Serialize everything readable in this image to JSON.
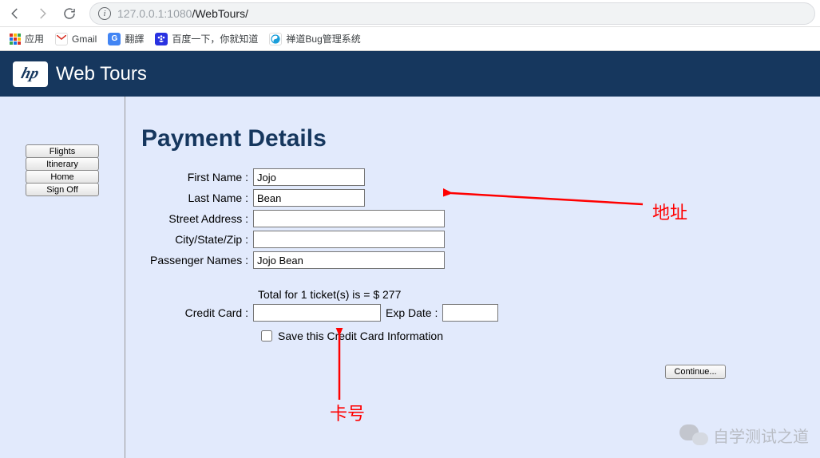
{
  "browser": {
    "url_host": "127.0.0.1",
    "url_port": ":1080",
    "url_path": "/WebTours/"
  },
  "bookmarks": {
    "apps": "应用",
    "gmail": "Gmail",
    "translate": "翻譯",
    "baidu": "百度一下，你就知道",
    "zentao": "禅道Bug管理系统"
  },
  "banner": {
    "title": "Web Tours"
  },
  "sidebar": {
    "flights": "Flights",
    "itinerary": "Itinerary",
    "home": "Home",
    "signoff": "Sign Off"
  },
  "page": {
    "title": "Payment Details",
    "labels": {
      "first_name": "First Name :",
      "last_name": "Last Name :",
      "street": "Street Address :",
      "city": "City/State/Zip :",
      "passenger": "Passenger Names :",
      "credit_card": "Credit Card :",
      "exp_date": "Exp Date :",
      "save_cc": "Save this Credit Card Information"
    },
    "values": {
      "first_name": "Jojo",
      "last_name": "Bean",
      "street": "",
      "city": "",
      "passenger": "Jojo Bean",
      "credit_card": "",
      "exp_date": ""
    },
    "total_line": "Total for 1 ticket(s) is = $ 277",
    "continue": "Continue..."
  },
  "annotations": {
    "address": "地址",
    "card_no": "卡号"
  },
  "watermark": {
    "text": "自学测试之道"
  }
}
